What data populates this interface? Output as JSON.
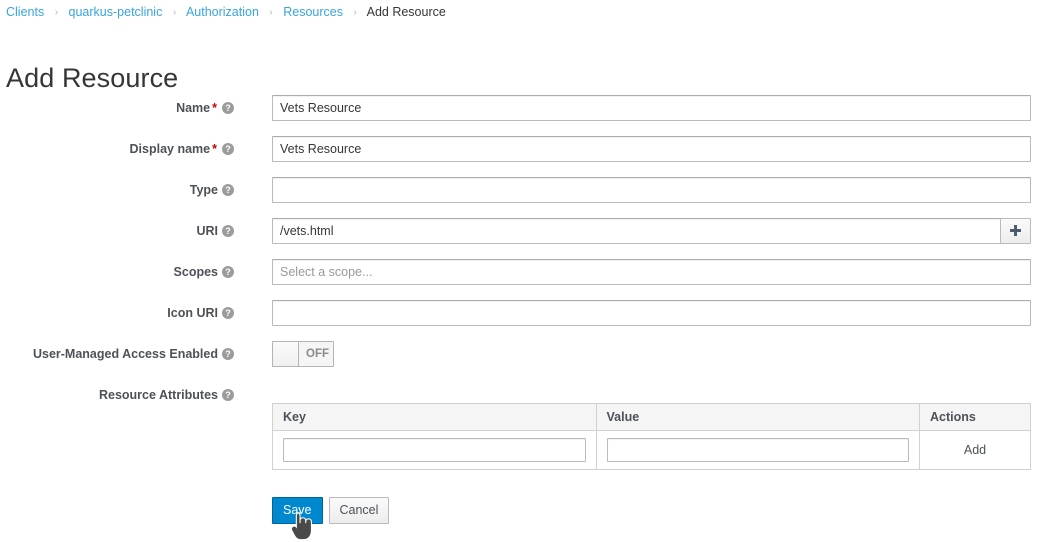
{
  "breadcrumb": {
    "separator": "›",
    "items": [
      {
        "label": "Clients",
        "link": true
      },
      {
        "label": "quarkus-petclinic",
        "link": true
      },
      {
        "label": "Authorization",
        "link": true
      },
      {
        "label": "Resources",
        "link": true
      },
      {
        "label": "Add Resource",
        "link": false
      }
    ]
  },
  "page": {
    "title": "Add Resource"
  },
  "form": {
    "help_glyph": "?",
    "required_marker": "*",
    "fields": [
      {
        "label": "Name",
        "required_marker": "*",
        "value": "Vets Resource",
        "placeholder": ""
      },
      {
        "label": "Display name",
        "required_marker": "*",
        "value": "Vets Resource",
        "placeholder": ""
      },
      {
        "label": "Type",
        "required_marker": "",
        "value": "",
        "placeholder": ""
      },
      {
        "label": "URI",
        "required_marker": "",
        "value": "/vets.html",
        "placeholder": ""
      },
      {
        "label": "Scopes",
        "required_marker": "",
        "value": "",
        "placeholder": "Select a scope..."
      },
      {
        "label": "Icon URI",
        "required_marker": "",
        "value": "",
        "placeholder": ""
      }
    ],
    "uri_add_icon": "plus-icon",
    "uma": {
      "label": "User-Managed Access Enabled",
      "state": "OFF"
    },
    "attributes": {
      "label": "Resource Attributes",
      "columns": [
        "Key",
        "Value",
        "Actions"
      ],
      "rows": [
        {
          "key": "",
          "value": "",
          "action": "Add"
        }
      ]
    }
  },
  "footer": {
    "save_label": "Save",
    "cancel_label": "Cancel"
  },
  "colors": {
    "link": "#39a5dc",
    "primary_button": "#0088ce",
    "required_asterisk": "#cc0000",
    "label_text": "#4d5258",
    "help_icon": "#9c9c9c"
  }
}
